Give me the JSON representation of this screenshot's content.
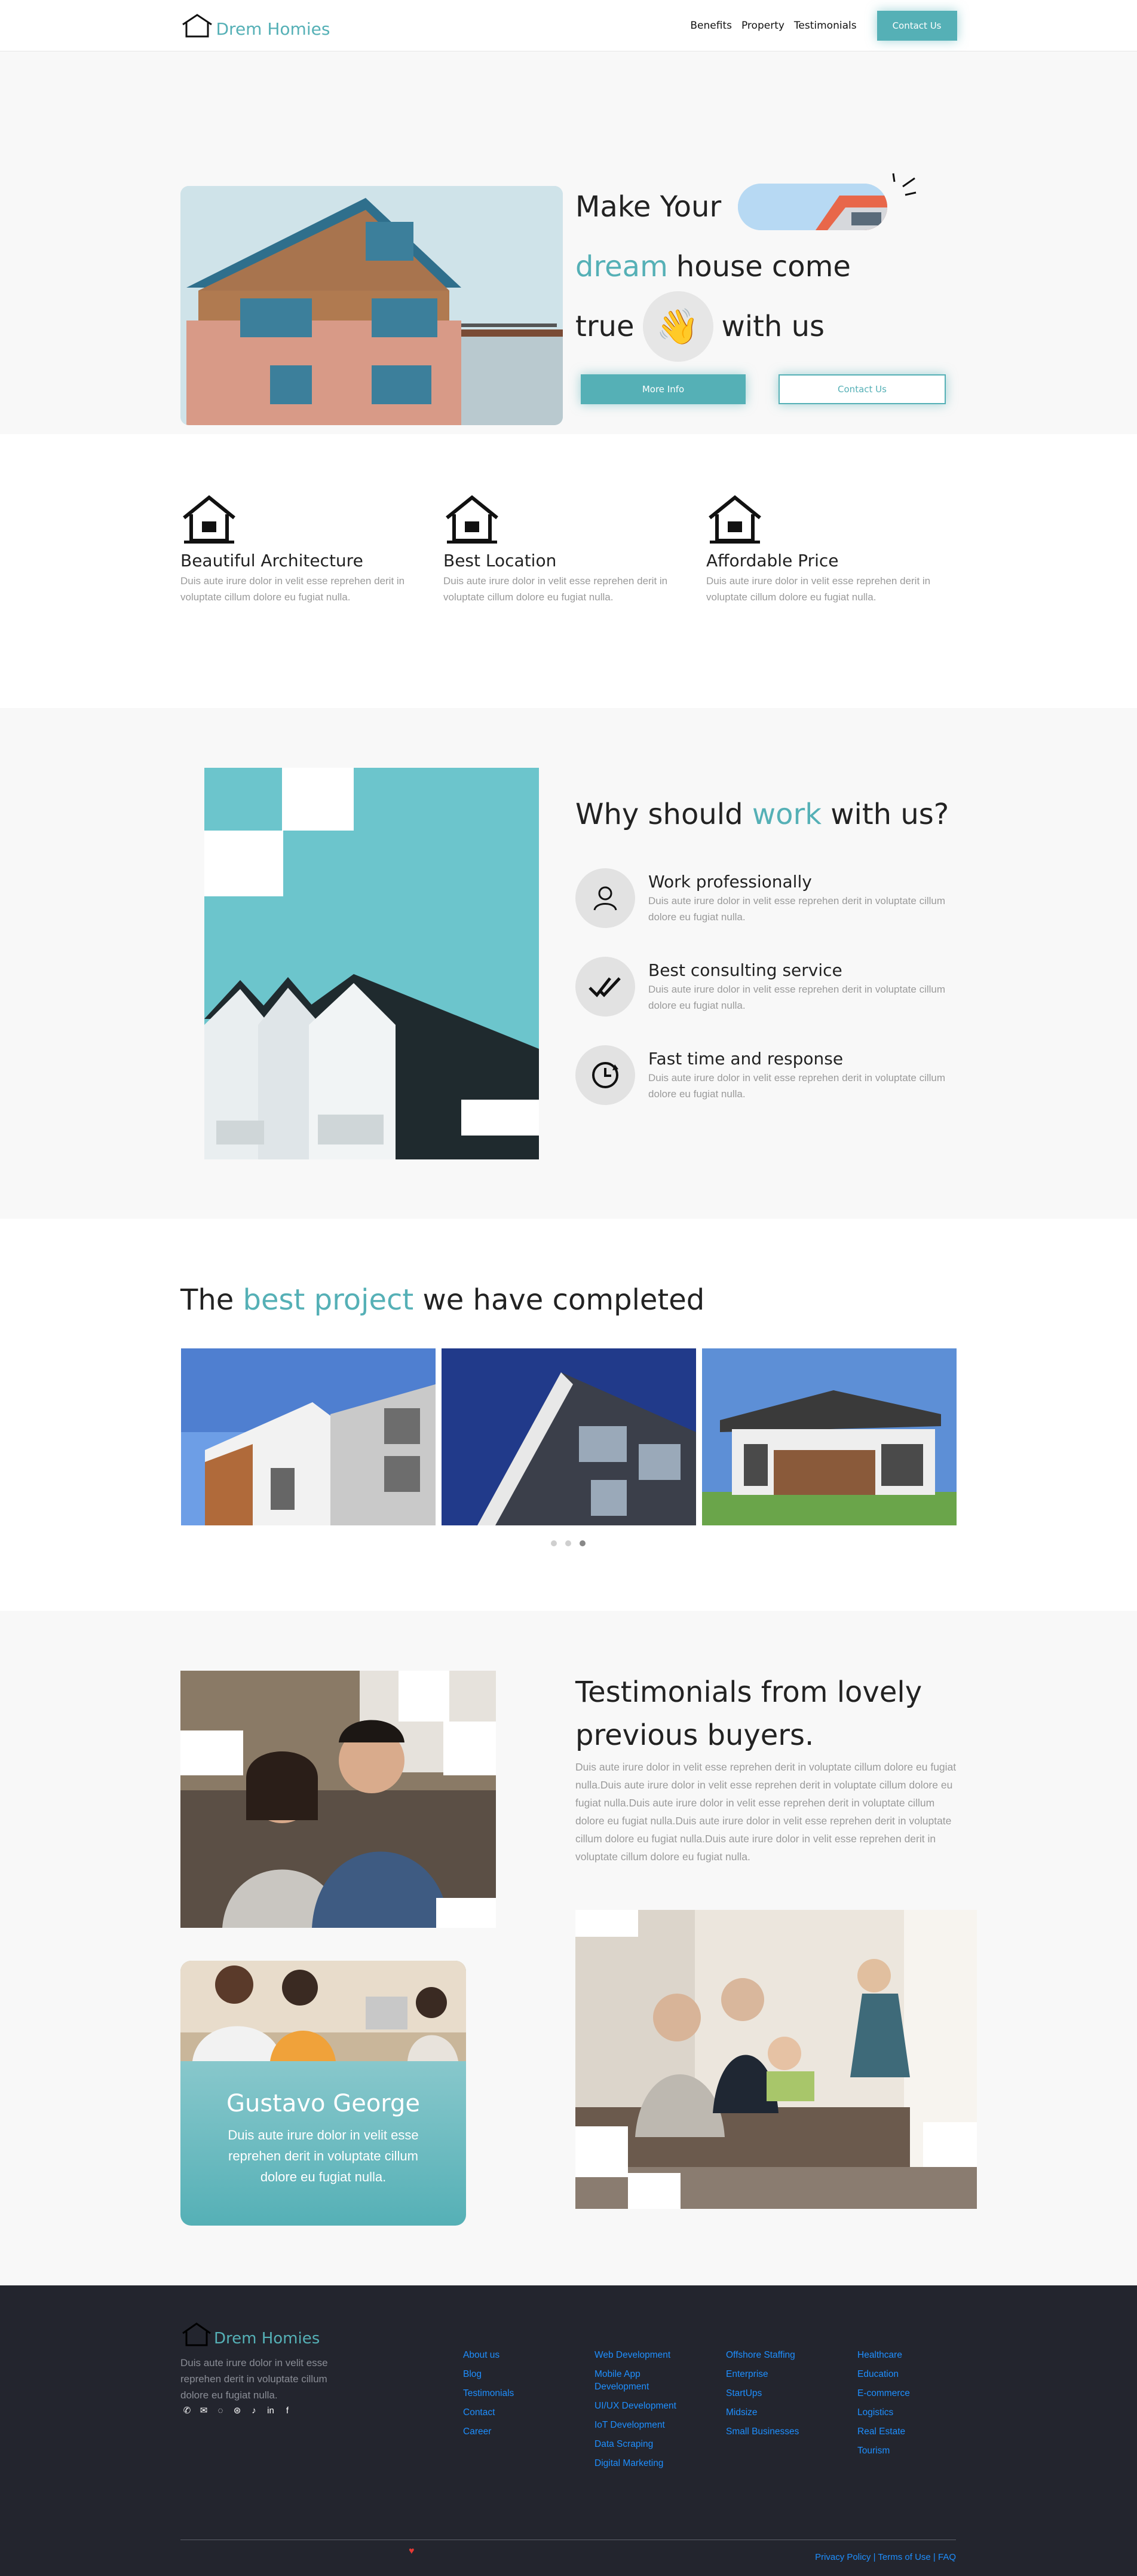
{
  "nav": {
    "brand": "Drem Homies",
    "links": [
      "Benefits",
      "Property",
      "Testimonials"
    ],
    "cta": "Contact Us"
  },
  "hero": {
    "line1": "Make Your",
    "line2_accent": "dream",
    "line2_rest": "house come",
    "line3a": "true",
    "line3b": "with us",
    "wave_emoji": "👋",
    "btn_primary": "More Info",
    "btn_secondary": "Contact Us"
  },
  "features": [
    {
      "title": "Beautiful Architecture",
      "desc": "Duis aute irure dolor in velit esse reprehen derit in voluptate cillum dolore eu fugiat nulla.",
      "icon": "house-icon"
    },
    {
      "title": "Best Location",
      "desc": "Duis aute irure dolor in velit esse reprehen derit in voluptate cillum dolore eu fugiat nulla.",
      "icon": "house-icon"
    },
    {
      "title": "Affordable Price",
      "desc": "Duis aute irure dolor in velit esse reprehen derit in voluptate cillum dolore eu fugiat nulla.",
      "icon": "house-icon"
    }
  ],
  "why": {
    "title_a": "Why should",
    "title_accent": "work",
    "title_b": "with us?",
    "items": [
      {
        "title": "Work professionally",
        "desc": "Duis aute irure dolor in velit esse reprehen derit in voluptate cillum dolore eu fugiat nulla.",
        "icon": "user-icon"
      },
      {
        "title": "Best consulting service",
        "desc": "Duis aute irure dolor in velit esse reprehen derit in voluptate cillum dolore eu fugiat nulla.",
        "icon": "double-check-icon"
      },
      {
        "title": "Fast time and response",
        "desc": "Duis aute irure dolor in velit esse reprehen derit in voluptate cillum dolore eu fugiat nulla.",
        "icon": "clock-icon"
      }
    ]
  },
  "projects": {
    "title_a": "The",
    "title_accent": "best project",
    "title_b": "we have completed"
  },
  "testimonials": {
    "title": "Testimonials from lovely previous buyers.",
    "text": "Duis aute irure dolor in velit esse reprehen derit in voluptate cillum dolore eu fugiat nulla.Duis aute irure dolor in velit esse reprehen derit in voluptate cillum dolore eu fugiat nulla.Duis aute irure dolor in velit esse reprehen derit in voluptate cillum dolore eu fugiat nulla.Duis aute irure dolor in velit esse reprehen derit in voluptate cillum dolore eu fugiat nulla.Duis aute irure dolor in velit esse reprehen derit in voluptate cillum dolore eu fugiat nulla.",
    "card_name": "Gustavo George",
    "card_text": "Duis aute irure dolor in velit esse reprehen derit in voluptate cillum dolore eu fugiat nulla."
  },
  "footer": {
    "brand": "Drem Homies",
    "about": "Duis aute irure dolor in velit esse reprehen derit in voluptate cillum dolore eu fugiat nulla.",
    "social": [
      "phone-icon",
      "mail-icon",
      "whatsapp-icon",
      "dribbble-icon",
      "twitter-icon",
      "linkedin-icon",
      "facebook-icon"
    ],
    "col1": [
      "About us",
      "Blog",
      "Testimonials",
      "Contact",
      "Career"
    ],
    "col2": [
      "Web Development",
      "Mobile App Development",
      "UI/UX Development",
      "IoT Development",
      "Data Scraping",
      "Digital Marketing"
    ],
    "col3": [
      "Offshore Staffing",
      "Enterprise",
      "StartUps",
      "Midsize",
      "Small Businesses"
    ],
    "col4": [
      "Healthcare",
      "Education",
      "E-commerce",
      "Logistics",
      "Real Estate",
      "Tourism"
    ],
    "heart": "♥",
    "legal": [
      "Privacy Policy",
      "Terms of Use",
      "FAQ"
    ],
    "legal_sep": " | "
  },
  "colors": {
    "accent": "#55b0b6",
    "footer_bg": "#23252e",
    "link": "#1e8fff"
  }
}
